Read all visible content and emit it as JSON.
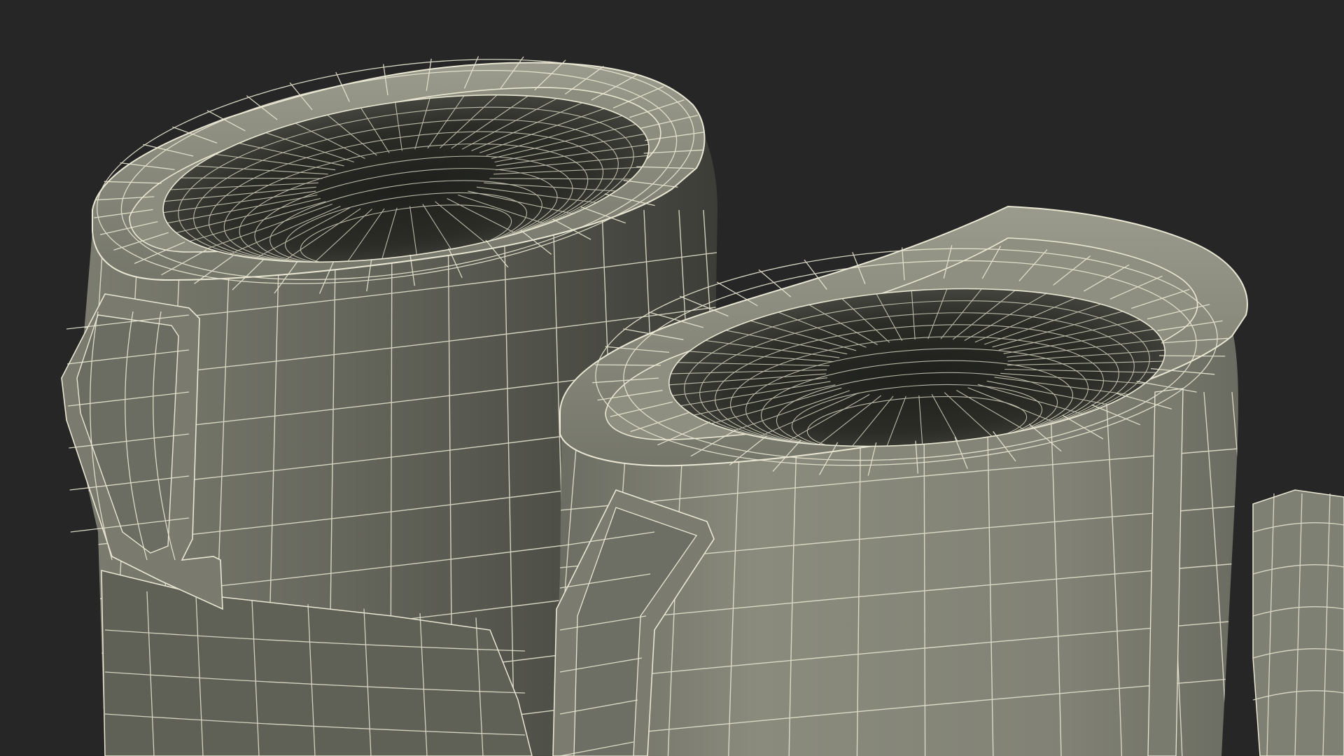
{
  "scene": {
    "subject": "two-rubber-boots-wireframe",
    "colors": {
      "background": "#262626",
      "surface_light": "#8a8a7c",
      "surface_mid": "#6f6f64",
      "surface_dark": "#45463f",
      "interior_dark": "#23241f",
      "wire": "#e9e7d3"
    }
  }
}
